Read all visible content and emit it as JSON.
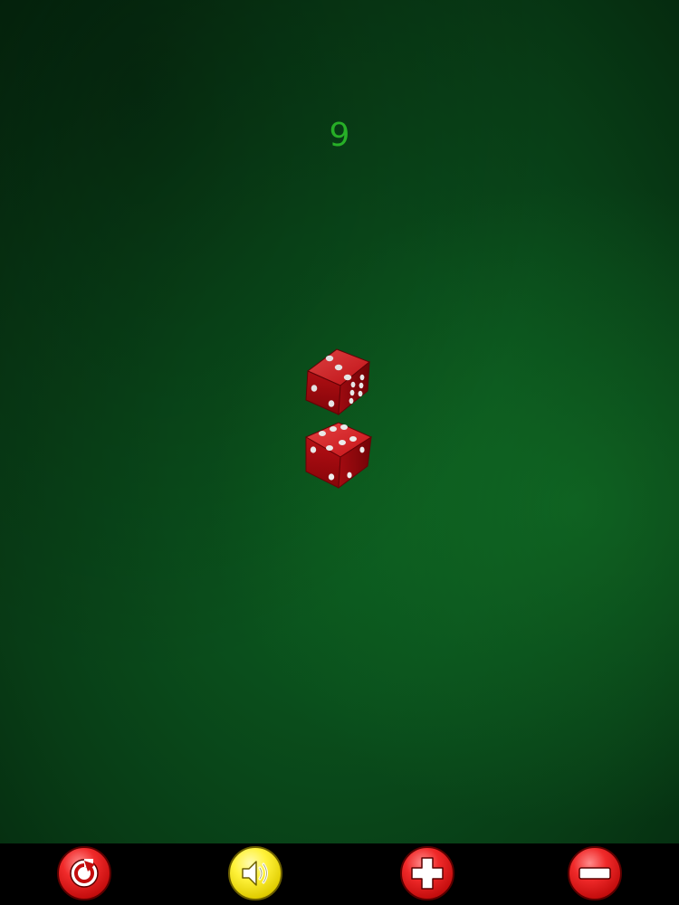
{
  "game": {
    "total": "9",
    "dice": [
      {
        "top_face": 3,
        "front_face": 1,
        "side_face": 6
      },
      {
        "top_face": 6,
        "front_face": 2,
        "side_face": 2
      }
    ],
    "die_color": "#d8181e",
    "table_color": "#0a4f1c",
    "total_color": "#2fd52f"
  },
  "toolbar": {
    "buttons": [
      {
        "icon": "reroll-icon",
        "color": "#e61f1f"
      },
      {
        "icon": "speaker-icon",
        "color": "#f5e626"
      },
      {
        "icon": "plus-icon",
        "color": "#e61f1f"
      },
      {
        "icon": "minus-icon",
        "color": "#e61f1f"
      }
    ]
  }
}
